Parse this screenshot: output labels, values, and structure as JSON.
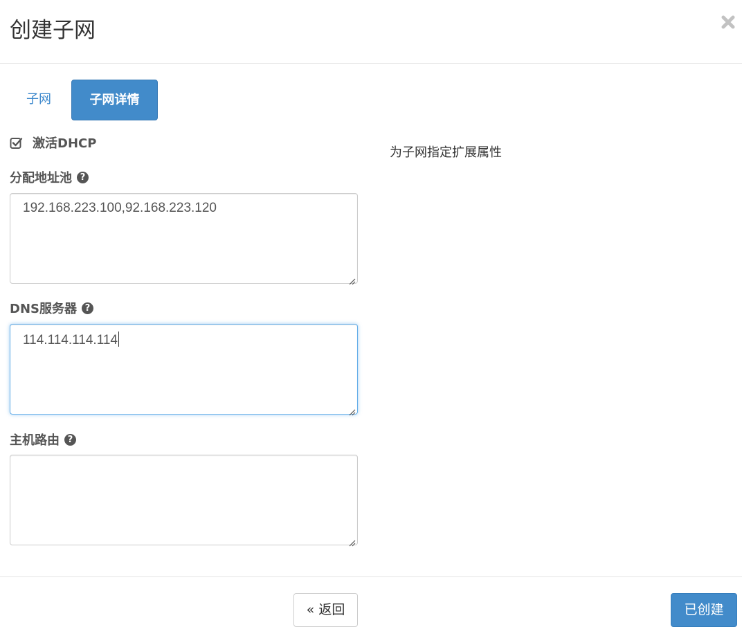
{
  "dialog": {
    "title": "创建子网",
    "close_icon": "close-icon"
  },
  "tabs": [
    {
      "label": "子网",
      "active": false
    },
    {
      "label": "子网详情",
      "active": true
    }
  ],
  "form": {
    "enable_dhcp": {
      "label": "激活DHCP",
      "checked": true
    },
    "allocation_pools": {
      "label": "分配地址池",
      "value": "192.168.223.100,92.168.223.120"
    },
    "dns_servers": {
      "label": "DNS服务器",
      "value": "114.114.114.114",
      "focused": true
    },
    "host_routes": {
      "label": "主机路由",
      "value": ""
    }
  },
  "help_text": "为子网指定扩展属性",
  "footer": {
    "back_label": "« 返回",
    "create_label": "已创建"
  },
  "colors": {
    "primary": "#428bca",
    "link": "#3a87cc",
    "focus_border": "#66afe9"
  }
}
